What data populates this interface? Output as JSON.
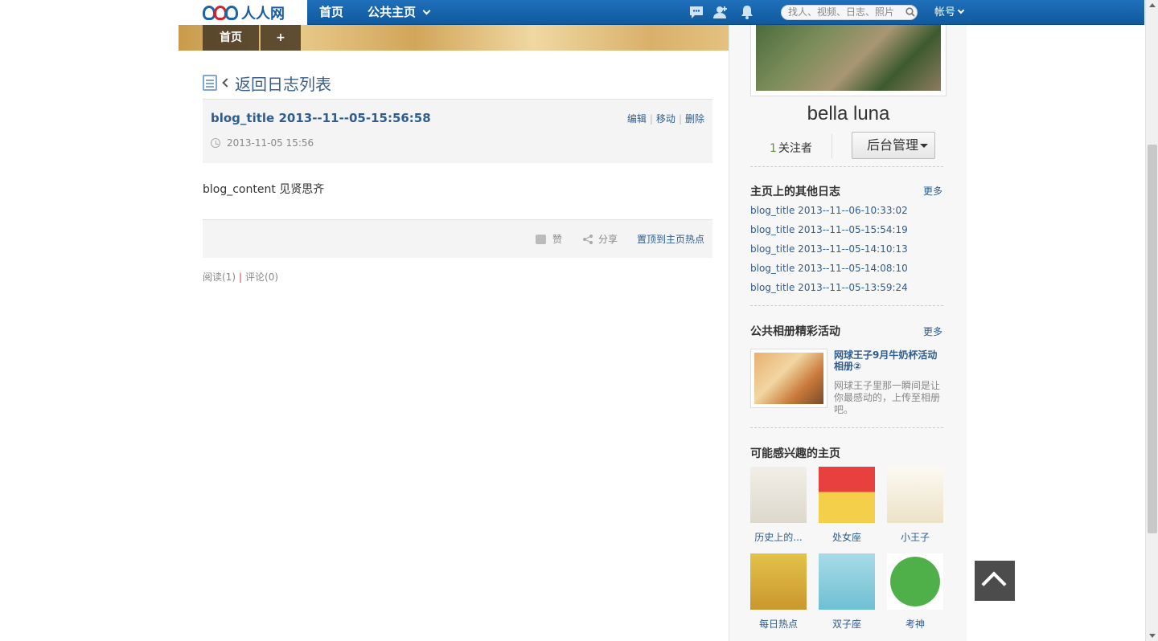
{
  "topbar": {
    "logo_text": "人人网",
    "nav_home": "首页",
    "nav_public": "公共主页",
    "search_placeholder": "找人、视频、日志、照片",
    "account": "帐号"
  },
  "banner": {
    "home_tab": "首页",
    "plus_tab": "+"
  },
  "main": {
    "back_text": "返回日志列表",
    "post": {
      "title": "blog_title 2013--11--05-15:56:58",
      "actions": [
        "编辑",
        "移动",
        "删除"
      ],
      "date": "2013-11-05 15:56",
      "content": "blog_content 见贤思齐"
    },
    "footer": {
      "like": "赞",
      "share": "分享",
      "pin": "置顶到主页热点"
    },
    "stats": {
      "reads": "阅读(1)",
      "comments": "评论(0)"
    }
  },
  "sidebar": {
    "profile_name": "bella luna",
    "followers_count": "1",
    "followers_label": "关注者",
    "admin_button": "后台管理",
    "other_blogs": {
      "title": "主页上的其他日志",
      "more": "更多",
      "items": [
        "blog_title 2013--11--06-10:33:02",
        "blog_title 2013--11--05-15:54:19",
        "blog_title 2013--11--05-14:10:13",
        "blog_title 2013--11--05-14:08:10",
        "blog_title 2013--11--05-13:59:24"
      ]
    },
    "albums": {
      "title": "公共相册精彩活动",
      "more": "更多",
      "item_title": "网球王子9月牛奶杯活动相册②",
      "item_desc": "网球王子里那一瞬间是让你最感动的，上传至相册吧。"
    },
    "suggested": {
      "title": "可能感兴趣的主页",
      "pages": [
        "历史上的...",
        "处女座",
        "小王子",
        "每日热点",
        "双子座",
        "考神"
      ]
    }
  },
  "colors": {
    "nav_blue": "#1a64ad",
    "link_blue": "#2f5d8f",
    "follower_green": "#5a9a2e"
  }
}
